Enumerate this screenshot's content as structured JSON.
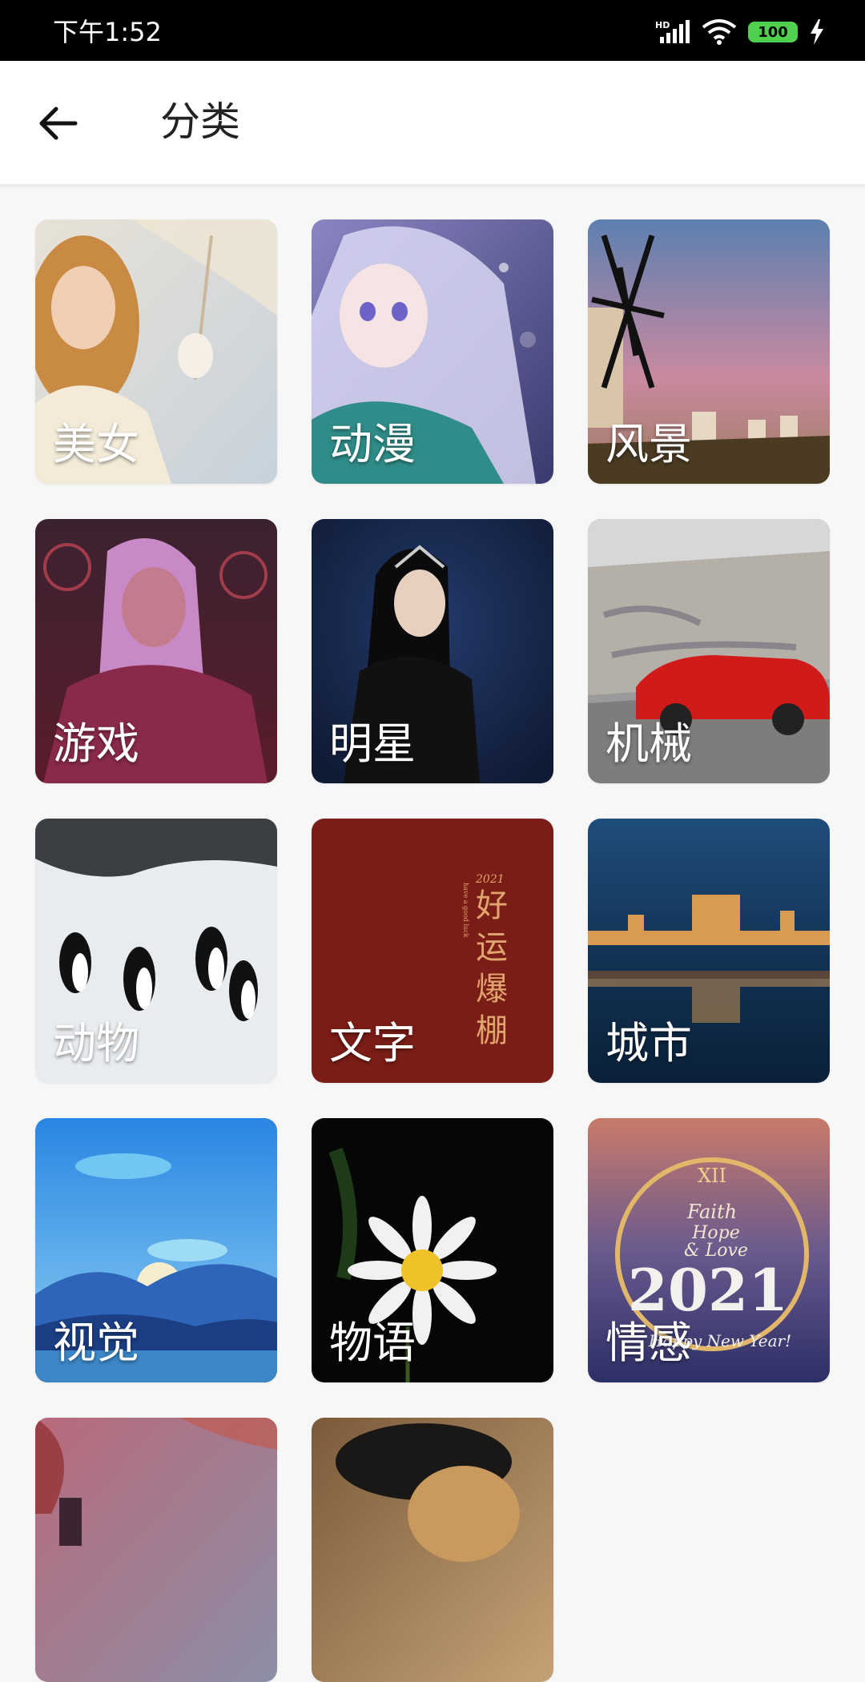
{
  "status_bar": {
    "time": "下午1:52",
    "battery": "100",
    "icons": [
      "hd-signal-icon",
      "wifi-icon",
      "battery-icon",
      "charging-bolt-icon"
    ]
  },
  "app_bar": {
    "back_icon": "arrow-left-icon",
    "title": "分类"
  },
  "categories": [
    {
      "label": "美女"
    },
    {
      "label": "动漫"
    },
    {
      "label": "风景"
    },
    {
      "label": "游戏"
    },
    {
      "label": "明星"
    },
    {
      "label": "机械"
    },
    {
      "label": "动物"
    },
    {
      "label": "文字",
      "art_text": {
        "year": "2021",
        "lines": [
          "好",
          "运",
          "爆",
          "棚"
        ],
        "sub": "have a good luck"
      }
    },
    {
      "label": "城市"
    },
    {
      "label": "视觉"
    },
    {
      "label": "物语"
    },
    {
      "label": "情感",
      "art_text": {
        "numerals": "XII",
        "line1": "Faith",
        "line2": "Hope",
        "line3": "& Love",
        "year": "2021",
        "greeting": "Happy New Year!"
      }
    },
    {
      "label": ""
    },
    {
      "label": ""
    }
  ]
}
